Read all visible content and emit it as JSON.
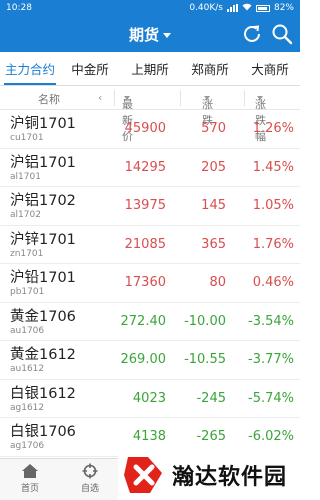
{
  "status": {
    "time": "10:28",
    "speed": "0.40K/s",
    "battery": "82%"
  },
  "appbar": {
    "title": "期货"
  },
  "tabs": [
    {
      "label": "主力合约",
      "active": true
    },
    {
      "label": "中金所",
      "active": false
    },
    {
      "label": "上期所",
      "active": false
    },
    {
      "label": "郑商所",
      "active": false
    },
    {
      "label": "大商所",
      "active": false
    }
  ],
  "columns": {
    "name": "名称",
    "arrow": "‹",
    "price": "最新价",
    "change": "涨跌",
    "percent": "涨跌幅"
  },
  "rows": [
    {
      "name": "沪铜1701",
      "code": "cu1701",
      "price": "45900",
      "change": "570",
      "percent": "1.26%",
      "dir": "up"
    },
    {
      "name": "沪铝1701",
      "code": "al1701",
      "price": "14295",
      "change": "205",
      "percent": "1.45%",
      "dir": "up"
    },
    {
      "name": "沪铝1702",
      "code": "al1702",
      "price": "13975",
      "change": "145",
      "percent": "1.05%",
      "dir": "up"
    },
    {
      "name": "沪锌1701",
      "code": "zn1701",
      "price": "21085",
      "change": "365",
      "percent": "1.76%",
      "dir": "up"
    },
    {
      "name": "沪铅1701",
      "code": "pb1701",
      "price": "17360",
      "change": "80",
      "percent": "0.46%",
      "dir": "up"
    },
    {
      "name": "黄金1706",
      "code": "au1706",
      "price": "272.40",
      "change": "-10.00",
      "percent": "-3.54%",
      "dir": "down"
    },
    {
      "name": "黄金1612",
      "code": "au1612",
      "price": "269.00",
      "change": "-10.55",
      "percent": "-3.77%",
      "dir": "down"
    },
    {
      "name": "白银1612",
      "code": "ag1612",
      "price": "4023",
      "change": "-245",
      "percent": "-5.74%",
      "dir": "down"
    },
    {
      "name": "白银1706",
      "code": "ag1706",
      "price": "4138",
      "change": "-265",
      "percent": "-6.02%",
      "dir": "down"
    }
  ],
  "bottom_nav": {
    "home": "首页",
    "favorites": "自选"
  },
  "watermark": {
    "text": "瀚达软件园"
  },
  "colors": {
    "brand": "#1a7fd3",
    "up": "#d94e4e",
    "down": "#3aa53a"
  }
}
